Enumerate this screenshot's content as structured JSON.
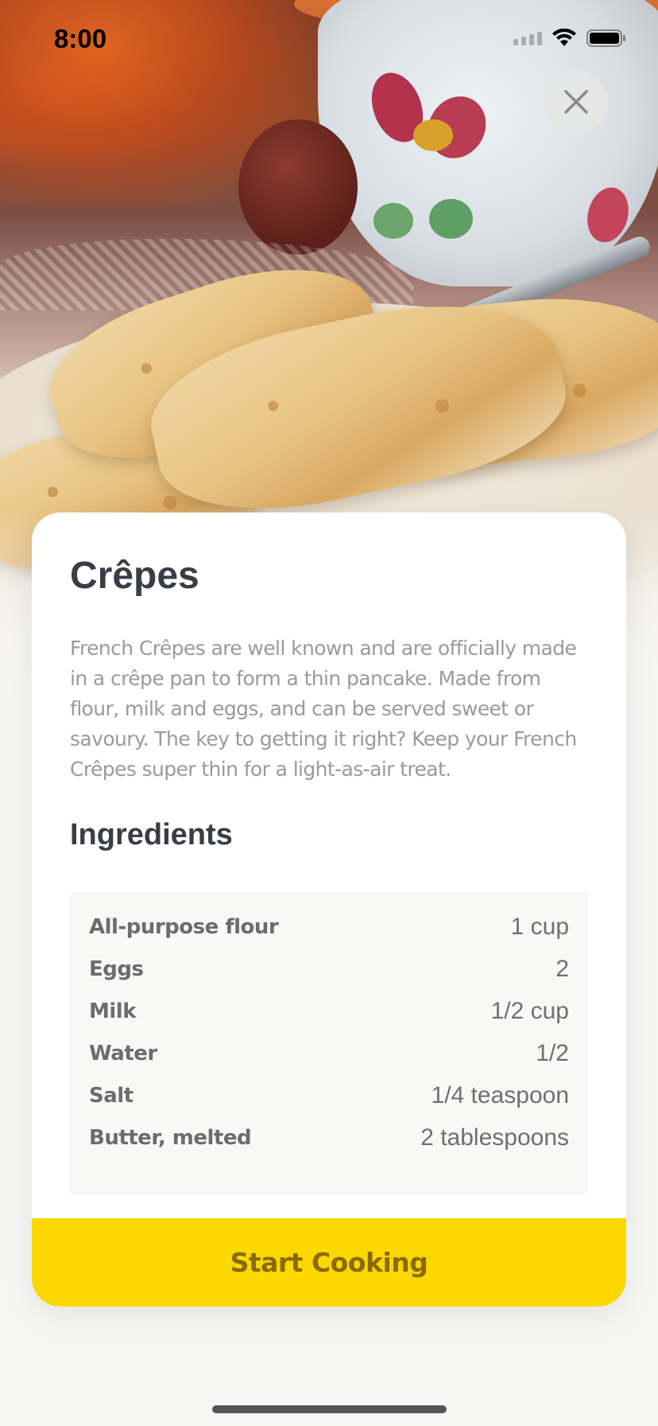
{
  "status_bar": {
    "time": "8:00"
  },
  "close_button": {
    "icon": "close-icon"
  },
  "recipe": {
    "title": "Crêpes",
    "description": "French Crêpes are well known and are officially made in a crêpe pan to form a thin pancake. Made from flour, milk and eggs, and can be served sweet or savoury. The key to getting it right? Keep your French Crêpes super thin for a light-as-air treat."
  },
  "ingredients": {
    "title": "Ingredients",
    "items": [
      {
        "name": "All-purpose flour",
        "quantity": "1 cup"
      },
      {
        "name": "Eggs",
        "quantity": "2"
      },
      {
        "name": "Milk",
        "quantity": "1/2 cup"
      },
      {
        "name": "Water",
        "quantity": "1/2"
      },
      {
        "name": "Salt",
        "quantity": "1/4 teaspoon"
      },
      {
        "name": "Butter, melted",
        "quantity": "2 tablespoons"
      }
    ]
  },
  "actions": {
    "start_label": "Start Cooking"
  },
  "colors": {
    "accent": "#fbd800",
    "accent_text": "#8a6a00",
    "title_text": "#3a3d45",
    "body_text": "#9a9a9a"
  }
}
